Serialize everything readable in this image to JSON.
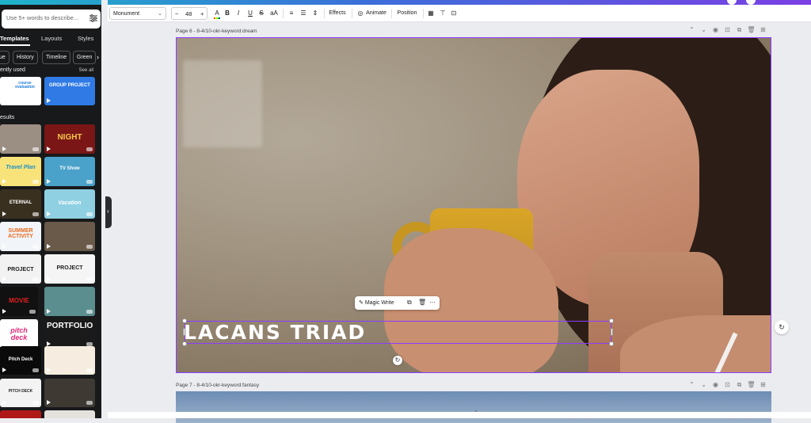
{
  "sidebar": {
    "search_placeholder": "Use 5+ words to describe...",
    "tabs": [
      "Templates",
      "Layouts",
      "Styles"
    ],
    "chips": [
      "ue",
      "History",
      "Timeline",
      "Green"
    ],
    "recently_used_title": "ently used",
    "see_all": "See all",
    "results_title": "esults",
    "thumbnails": {
      "course_eval": "course evaluation",
      "group_project": "GROUP PROJECT",
      "night": "NIGHT",
      "travel_plan": "Travel Plan",
      "tv_show": "TV Show",
      "eternal": "ETERNAL",
      "vacation": "Vacation",
      "summer": "SUMMER ACTIVITY",
      "project1": "PROJECT",
      "project2": "PROJECT",
      "movie": "MOVIE",
      "pitch": "pitch deck",
      "portfolio": "PORTFOLIO",
      "pitch_deck_dark": "Pitch Deck",
      "pitch_deck2": "PITCH DECK"
    }
  },
  "toolbar": {
    "font": "Monument",
    "font_size": "48",
    "minus": "−",
    "plus": "+",
    "bold": "B",
    "italic": "I",
    "underline": "U",
    "strike": "S",
    "case": "aA",
    "effects": "Effects",
    "animate": "Animate",
    "position": "Position"
  },
  "canvas": {
    "page6_label": "Page 6 - 8-4/10-okr-keyword:dream",
    "page7_label": "Page 7 - 8-4/10-okr-keyword:fantasy",
    "title_text": "LACANS TRIAD",
    "magic_write": "Magic Write"
  },
  "colors": {
    "accent": "#8b3dff",
    "sidebar_bg": "#18191b"
  }
}
